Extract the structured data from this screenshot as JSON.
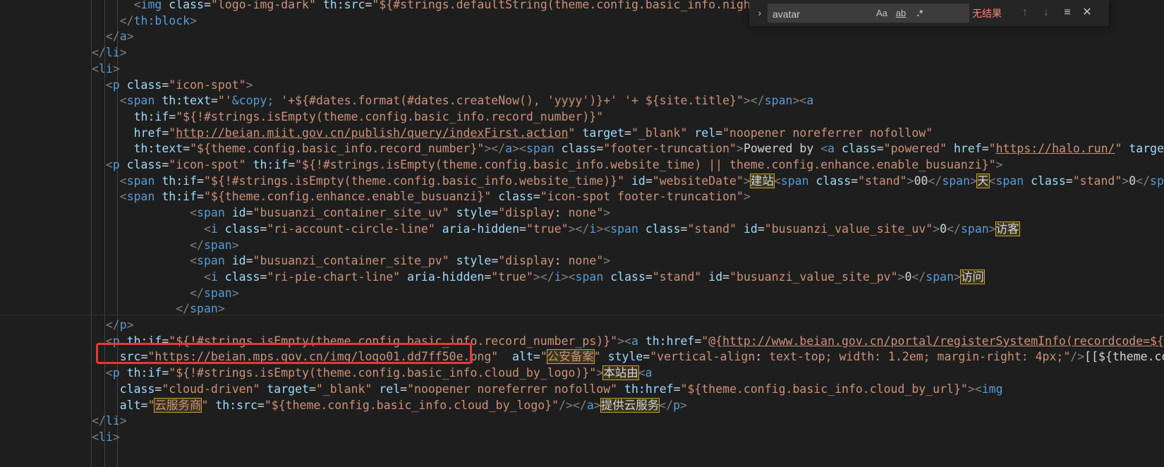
{
  "find_widget": {
    "query": "avatar",
    "match_case_label": "Aa",
    "whole_word_label": "ab",
    "regex_label": ".*",
    "no_results": "无结果",
    "toggle_glyph": "›",
    "prev_glyph": "↑",
    "next_glyph": "↓",
    "selection_glyph": "≡",
    "close_glyph": "✕"
  },
  "code_lines": [
    [
      [
        "t-text",
        "      "
      ],
      [
        "t-br",
        "<"
      ],
      [
        "t-tag",
        "img"
      ],
      [
        "t-text",
        " "
      ],
      [
        "t-attr",
        "class"
      ],
      [
        "t-text",
        "="
      ],
      [
        "t-str",
        "\"logo-img-dark\""
      ],
      [
        "t-text",
        " "
      ],
      [
        "t-attr",
        "th:src"
      ],
      [
        "t-text",
        "="
      ],
      [
        "t-str",
        "\"${#strings.defaultString(theme.config.basic_info.night_logo,"
      ]
    ],
    [
      [
        "t-text",
        "    "
      ],
      [
        "t-br",
        "</"
      ],
      [
        "t-tag",
        "th:block"
      ],
      [
        "t-br",
        ">"
      ]
    ],
    [
      [
        "t-text",
        "  "
      ],
      [
        "t-br",
        "</"
      ],
      [
        "t-tag",
        "a"
      ],
      [
        "t-br",
        ">"
      ]
    ],
    [
      [
        "t-br",
        "</"
      ],
      [
        "t-tag",
        "li"
      ],
      [
        "t-br",
        ">"
      ]
    ],
    [
      [
        "t-br",
        "<"
      ],
      [
        "t-tag",
        "li"
      ],
      [
        "t-br",
        ">"
      ]
    ],
    [
      [
        "t-text",
        "  "
      ],
      [
        "t-br",
        "<"
      ],
      [
        "t-tag",
        "p"
      ],
      [
        "t-text",
        " "
      ],
      [
        "t-attr",
        "class"
      ],
      [
        "t-text",
        "="
      ],
      [
        "t-str",
        "\"icon-spot\""
      ],
      [
        "t-br",
        ">"
      ]
    ],
    [
      [
        "t-text",
        "    "
      ],
      [
        "t-br",
        "<"
      ],
      [
        "t-tag",
        "span"
      ],
      [
        "t-text",
        " "
      ],
      [
        "t-attr",
        "th:text"
      ],
      [
        "t-text",
        "="
      ],
      [
        "t-str",
        "\"'"
      ],
      [
        "t-ent",
        "&copy;"
      ],
      [
        "t-str",
        " '+${#dates.format(#dates.createNow(), 'yyyy')}+' '+ ${site.title}\""
      ],
      [
        "t-br",
        "></"
      ],
      [
        "t-tag",
        "span"
      ],
      [
        "t-br",
        "><"
      ],
      [
        "t-tag",
        "a"
      ]
    ],
    [
      [
        "t-text",
        "      "
      ],
      [
        "t-attr",
        "th:if"
      ],
      [
        "t-text",
        "="
      ],
      [
        "t-str",
        "\"${!#strings.isEmpty(theme.config.basic_info.record_number)}\""
      ]
    ],
    [
      [
        "t-text",
        "      "
      ],
      [
        "t-attr",
        "href"
      ],
      [
        "t-text",
        "="
      ],
      [
        "t-str",
        "\""
      ],
      [
        "t-str t-link",
        "http://beian.miit.gov.cn/publish/query/indexFirst.action"
      ],
      [
        "t-str",
        "\""
      ],
      [
        "t-text",
        " "
      ],
      [
        "t-attr",
        "target"
      ],
      [
        "t-text",
        "="
      ],
      [
        "t-str",
        "\"_blank\""
      ],
      [
        "t-text",
        " "
      ],
      [
        "t-attr",
        "rel"
      ],
      [
        "t-text",
        "="
      ],
      [
        "t-str",
        "\"noopener noreferrer nofollow\""
      ]
    ],
    [
      [
        "t-text",
        "      "
      ],
      [
        "t-attr",
        "th:text"
      ],
      [
        "t-text",
        "="
      ],
      [
        "t-str",
        "\"${theme.config.basic_info.record_number}\""
      ],
      [
        "t-br",
        "></"
      ],
      [
        "t-tag",
        "a"
      ],
      [
        "t-br",
        "><"
      ],
      [
        "t-tag",
        "span"
      ],
      [
        "t-text",
        " "
      ],
      [
        "t-attr",
        "class"
      ],
      [
        "t-text",
        "="
      ],
      [
        "t-str",
        "\"footer-truncation\""
      ],
      [
        "t-br",
        ">"
      ],
      [
        "t-text",
        "Powered by "
      ],
      [
        "t-br",
        "<"
      ],
      [
        "t-tag",
        "a"
      ],
      [
        "t-text",
        " "
      ],
      [
        "t-attr",
        "class"
      ],
      [
        "t-text",
        "="
      ],
      [
        "t-str",
        "\"powered\""
      ],
      [
        "t-text",
        " "
      ],
      [
        "t-attr",
        "href"
      ],
      [
        "t-text",
        "="
      ],
      [
        "t-str",
        "\""
      ],
      [
        "t-str t-link",
        "https://halo.run/"
      ],
      [
        "t-str",
        "\""
      ],
      [
        "t-text",
        " "
      ],
      [
        "t-attr",
        "target"
      ],
      [
        "t-text",
        "="
      ],
      [
        "t-str",
        "\"_"
      ]
    ],
    [
      [
        "t-text",
        "  "
      ],
      [
        "t-br",
        "<"
      ],
      [
        "t-tag",
        "p"
      ],
      [
        "t-text",
        " "
      ],
      [
        "t-attr",
        "class"
      ],
      [
        "t-text",
        "="
      ],
      [
        "t-str",
        "\"icon-spot\""
      ],
      [
        "t-text",
        " "
      ],
      [
        "t-attr",
        "th:if"
      ],
      [
        "t-text",
        "="
      ],
      [
        "t-str",
        "\"${!#strings.isEmpty(theme.config.basic_info.website_time) || theme.config.enhance.enable_busuanzi}\""
      ],
      [
        "t-br",
        ">"
      ]
    ],
    [
      [
        "t-text",
        "    "
      ],
      [
        "t-br",
        "<"
      ],
      [
        "t-tag",
        "span"
      ],
      [
        "t-text",
        " "
      ],
      [
        "t-attr",
        "th:if"
      ],
      [
        "t-text",
        "="
      ],
      [
        "t-str",
        "\"${!#strings.isEmpty(theme.config.basic_info.website_time)}\""
      ],
      [
        "t-text",
        " "
      ],
      [
        "t-attr",
        "id"
      ],
      [
        "t-text",
        "="
      ],
      [
        "t-str",
        "\"websiteDate\""
      ],
      [
        "t-br",
        ">"
      ],
      [
        "t-text t-hit",
        "建站"
      ],
      [
        "t-br",
        "<"
      ],
      [
        "t-tag",
        "span"
      ],
      [
        "t-text",
        " "
      ],
      [
        "t-attr",
        "class"
      ],
      [
        "t-text",
        "="
      ],
      [
        "t-str",
        "\"stand\""
      ],
      [
        "t-br",
        ">"
      ],
      [
        "t-text",
        "00"
      ],
      [
        "t-br",
        "</"
      ],
      [
        "t-tag",
        "span"
      ],
      [
        "t-br",
        ">"
      ],
      [
        "t-text t-hit",
        "天"
      ],
      [
        "t-br",
        "<"
      ],
      [
        "t-tag",
        "span"
      ],
      [
        "t-text",
        " "
      ],
      [
        "t-attr",
        "class"
      ],
      [
        "t-text",
        "="
      ],
      [
        "t-str",
        "\"stand\""
      ],
      [
        "t-br",
        ">"
      ],
      [
        "t-text",
        "0"
      ],
      [
        "t-br",
        "</"
      ],
      [
        "t-tag",
        "span"
      ],
      [
        "t-br",
        ">"
      ],
      [
        "t-text t-hit",
        "时"
      ]
    ],
    [
      [
        "t-text",
        "    "
      ],
      [
        "t-br",
        "<"
      ],
      [
        "t-tag",
        "span"
      ],
      [
        "t-text",
        " "
      ],
      [
        "t-attr",
        "th:if"
      ],
      [
        "t-text",
        "="
      ],
      [
        "t-str",
        "\"${theme.config.enhance.enable_busuanzi}\""
      ],
      [
        "t-text",
        " "
      ],
      [
        "t-attr",
        "class"
      ],
      [
        "t-text",
        "="
      ],
      [
        "t-str",
        "\"icon-spot footer-truncation\""
      ],
      [
        "t-br",
        ">"
      ]
    ],
    [
      [
        "t-text",
        "              "
      ],
      [
        "t-br",
        "<"
      ],
      [
        "t-tag",
        "span"
      ],
      [
        "t-text",
        " "
      ],
      [
        "t-attr",
        "id"
      ],
      [
        "t-text",
        "="
      ],
      [
        "t-str",
        "\"busuanzi_container_site_uv\""
      ],
      [
        "t-text",
        " "
      ],
      [
        "t-attr",
        "style"
      ],
      [
        "t-text",
        "="
      ],
      [
        "t-str",
        "\"display"
      ],
      [
        "t-text",
        ": "
      ],
      [
        "t-str",
        "none\""
      ],
      [
        "t-br",
        ">"
      ]
    ],
    [
      [
        "t-text",
        "                "
      ],
      [
        "t-br",
        "<"
      ],
      [
        "t-tag",
        "i"
      ],
      [
        "t-text",
        " "
      ],
      [
        "t-attr",
        "class"
      ],
      [
        "t-text",
        "="
      ],
      [
        "t-str",
        "\"ri-account-circle-line\""
      ],
      [
        "t-text",
        " "
      ],
      [
        "t-attr",
        "aria-hidden"
      ],
      [
        "t-text",
        "="
      ],
      [
        "t-str",
        "\"true\""
      ],
      [
        "t-br",
        "></"
      ],
      [
        "t-tag",
        "i"
      ],
      [
        "t-br",
        "><"
      ],
      [
        "t-tag",
        "span"
      ],
      [
        "t-text",
        " "
      ],
      [
        "t-attr",
        "class"
      ],
      [
        "t-text",
        "="
      ],
      [
        "t-str",
        "\"stand\""
      ],
      [
        "t-text",
        " "
      ],
      [
        "t-attr",
        "id"
      ],
      [
        "t-text",
        "="
      ],
      [
        "t-str",
        "\"busuanzi_value_site_uv\""
      ],
      [
        "t-br",
        ">"
      ],
      [
        "t-text",
        "0"
      ],
      [
        "t-br",
        "</"
      ],
      [
        "t-tag",
        "span"
      ],
      [
        "t-br",
        ">"
      ],
      [
        "t-text t-hit",
        "访客"
      ]
    ],
    [
      [
        "t-text",
        "              "
      ],
      [
        "t-br",
        "</"
      ],
      [
        "t-tag",
        "span"
      ],
      [
        "t-br",
        ">"
      ]
    ],
    [
      [
        "t-text",
        "              "
      ],
      [
        "t-br",
        "<"
      ],
      [
        "t-tag",
        "span"
      ],
      [
        "t-text",
        " "
      ],
      [
        "t-attr",
        "id"
      ],
      [
        "t-text",
        "="
      ],
      [
        "t-str",
        "\"busuanzi_container_site_pv\""
      ],
      [
        "t-text",
        " "
      ],
      [
        "t-attr",
        "style"
      ],
      [
        "t-text",
        "="
      ],
      [
        "t-str",
        "\"display"
      ],
      [
        "t-text",
        ": "
      ],
      [
        "t-str",
        "none\""
      ],
      [
        "t-br",
        ">"
      ]
    ],
    [
      [
        "t-text",
        "                "
      ],
      [
        "t-br",
        "<"
      ],
      [
        "t-tag",
        "i"
      ],
      [
        "t-text",
        " "
      ],
      [
        "t-attr",
        "class"
      ],
      [
        "t-text",
        "="
      ],
      [
        "t-str",
        "\"ri-pie-chart-line\""
      ],
      [
        "t-text",
        " "
      ],
      [
        "t-attr",
        "aria-hidden"
      ],
      [
        "t-text",
        "="
      ],
      [
        "t-str",
        "\"true\""
      ],
      [
        "t-br",
        "></"
      ],
      [
        "t-tag",
        "i"
      ],
      [
        "t-br",
        "><"
      ],
      [
        "t-tag",
        "span"
      ],
      [
        "t-text",
        " "
      ],
      [
        "t-attr",
        "class"
      ],
      [
        "t-text",
        "="
      ],
      [
        "t-str",
        "\"stand\""
      ],
      [
        "t-text",
        " "
      ],
      [
        "t-attr",
        "id"
      ],
      [
        "t-text",
        "="
      ],
      [
        "t-str",
        "\"busuanzi_value_site_pv\""
      ],
      [
        "t-br",
        ">"
      ],
      [
        "t-text",
        "0"
      ],
      [
        "t-br",
        "</"
      ],
      [
        "t-tag",
        "span"
      ],
      [
        "t-br",
        ">"
      ],
      [
        "t-text t-hit",
        "访问"
      ]
    ],
    [
      [
        "t-text",
        "              "
      ],
      [
        "t-br",
        "</"
      ],
      [
        "t-tag",
        "span"
      ],
      [
        "t-br",
        ">"
      ]
    ],
    [
      [
        "t-text",
        "            "
      ],
      [
        "t-br",
        "</"
      ],
      [
        "t-tag",
        "span"
      ],
      [
        "t-br",
        ">"
      ]
    ],
    [
      [
        "t-text",
        "  "
      ],
      [
        "t-br",
        "</"
      ],
      [
        "t-tag",
        "p"
      ],
      [
        "t-br",
        ">"
      ]
    ],
    [
      [
        "t-text",
        "  "
      ],
      [
        "t-br",
        "<"
      ],
      [
        "t-tag",
        "p"
      ],
      [
        "t-text",
        " "
      ],
      [
        "t-attr",
        "th:if"
      ],
      [
        "t-text",
        "="
      ],
      [
        "t-str",
        "\"${!#strings.isEmpty(theme.config.basic_info.record_number_ps)}\""
      ],
      [
        "t-br",
        "><"
      ],
      [
        "t-tag",
        "a"
      ],
      [
        "t-text",
        " "
      ],
      [
        "t-attr",
        "th:href"
      ],
      [
        "t-text",
        "="
      ],
      [
        "t-str",
        "\"@{"
      ],
      [
        "t-str t-link",
        "http://www.beian.gov.cn/portal/registerSystemInfo(recordcode=${theme"
      ]
    ],
    [
      [
        "t-text",
        "    "
      ],
      [
        "t-attr",
        "src"
      ],
      [
        "t-text",
        "="
      ],
      [
        "t-str",
        "\"https://beian.mps.gov.cn/img/logo01.dd7ff50e.png\""
      ],
      [
        "t-text",
        "  "
      ],
      [
        "t-attr",
        "alt"
      ],
      [
        "t-text",
        "="
      ],
      [
        "t-str",
        "\""
      ],
      [
        "t-str t-hit",
        "公安备案"
      ],
      [
        "t-str",
        "\""
      ],
      [
        "t-text",
        " "
      ],
      [
        "t-attr",
        "style"
      ],
      [
        "t-text",
        "="
      ],
      [
        "t-str",
        "\"vertical-align"
      ],
      [
        "t-text",
        ": "
      ],
      [
        "t-str",
        "text-top; width: 1.2em; margin-right: 4px;\""
      ],
      [
        "t-br",
        "/>"
      ],
      [
        "t-text",
        "[[${theme.config"
      ]
    ],
    [
      [
        "t-text",
        "  "
      ],
      [
        "t-br",
        "<"
      ],
      [
        "t-tag",
        "p"
      ],
      [
        "t-text",
        " "
      ],
      [
        "t-attr",
        "th:if"
      ],
      [
        "t-text",
        "="
      ],
      [
        "t-str",
        "\"${!#strings.isEmpty(theme.config.basic_info.cloud_by_logo)}\""
      ],
      [
        "t-br",
        ">"
      ],
      [
        "t-text t-hit",
        "本站由"
      ],
      [
        "t-br",
        "<"
      ],
      [
        "t-tag",
        "a"
      ]
    ],
    [
      [
        "t-text",
        "    "
      ],
      [
        "t-attr",
        "class"
      ],
      [
        "t-text",
        "="
      ],
      [
        "t-str",
        "\"cloud-driven\""
      ],
      [
        "t-text",
        " "
      ],
      [
        "t-attr",
        "target"
      ],
      [
        "t-text",
        "="
      ],
      [
        "t-str",
        "\"_blank\""
      ],
      [
        "t-text",
        " "
      ],
      [
        "t-attr",
        "rel"
      ],
      [
        "t-text",
        "="
      ],
      [
        "t-str",
        "\"noopener noreferrer nofollow\""
      ],
      [
        "t-text",
        " "
      ],
      [
        "t-attr",
        "th:href"
      ],
      [
        "t-text",
        "="
      ],
      [
        "t-str",
        "\"${theme.config.basic_info.cloud_by_url}\""
      ],
      [
        "t-br",
        "><"
      ],
      [
        "t-tag",
        "img"
      ]
    ],
    [
      [
        "t-text",
        "    "
      ],
      [
        "t-attr",
        "alt"
      ],
      [
        "t-text",
        "="
      ],
      [
        "t-str",
        "\""
      ],
      [
        "t-str t-hit",
        "云服务商"
      ],
      [
        "t-str",
        "\""
      ],
      [
        "t-text",
        " "
      ],
      [
        "t-attr",
        "th:src"
      ],
      [
        "t-text",
        "="
      ],
      [
        "t-str",
        "\"${theme.config.basic_info.cloud_by_logo}\""
      ],
      [
        "t-br",
        "/></"
      ],
      [
        "t-tag",
        "a"
      ],
      [
        "t-br",
        ">"
      ],
      [
        "t-text t-hit",
        "提供云服务"
      ],
      [
        "t-br",
        "</"
      ],
      [
        "t-tag",
        "p"
      ],
      [
        "t-br",
        ">"
      ]
    ],
    [
      [
        "t-br",
        "</"
      ],
      [
        "t-tag",
        "li"
      ],
      [
        "t-br",
        ">"
      ]
    ],
    [
      [
        "t-br",
        "<"
      ],
      [
        "t-tag",
        "li"
      ],
      [
        "t-br",
        ">"
      ]
    ]
  ]
}
